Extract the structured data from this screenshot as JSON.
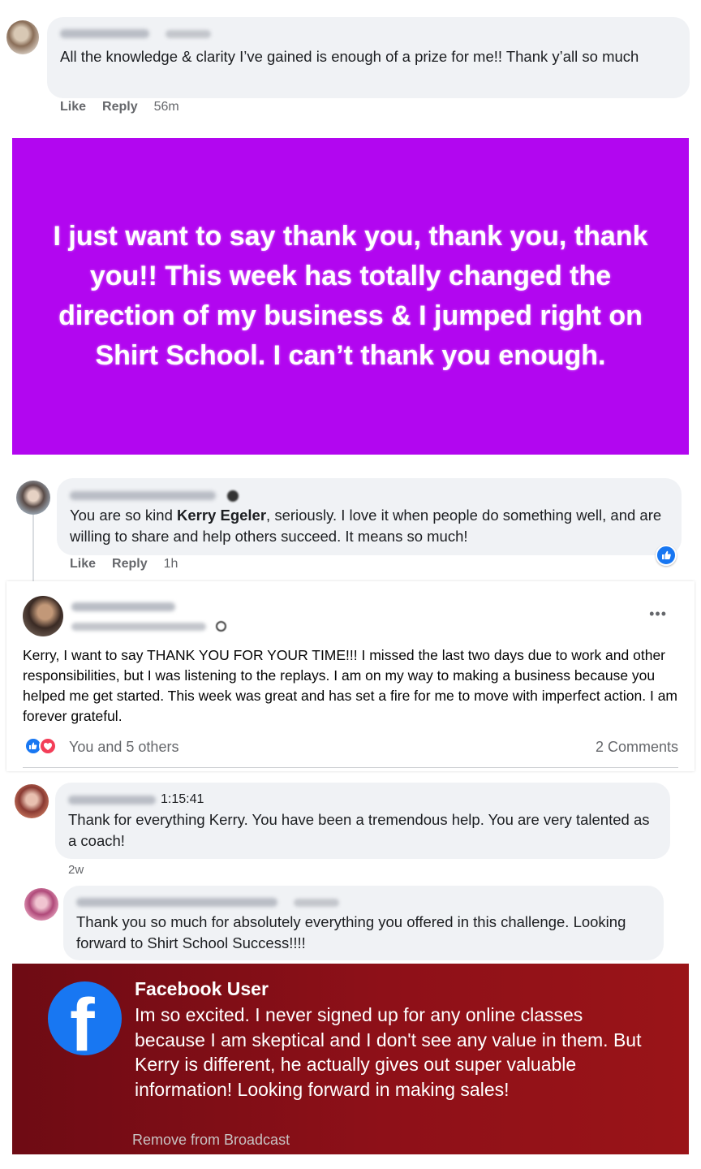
{
  "comment1": {
    "text": "All the knowledge & clarity I’ve gained is enough of a prize for me!! Thank y’all so much",
    "like": "Like",
    "reply": "Reply",
    "ago": "56m"
  },
  "purple_banner": {
    "text": "I just want to say thank you, thank you, thank you!! This week has totally changed the direction of my business & I jumped right on Shirt School. I can’t thank you enough."
  },
  "comment2": {
    "text_before": "You are so kind ",
    "mention": "Kerry Egeler",
    "text_after": ", seriously. I love it when people do something well, and are willing to share and help others succeed. It means so much!",
    "like": "Like",
    "reply": "Reply",
    "ago": "1h"
  },
  "post": {
    "text": "Kerry, I want to say THANK YOU FOR YOUR TIME!!! I missed the last two days due to work and other responsibilities, but I was listening to the replays. I am on my way to making a business because you helped me get started. This week was great and has set a fire for me to move with imperfect action. I am forever grateful.",
    "reactions": "You and 5 others",
    "comments": "2 Comments",
    "more": "•••"
  },
  "comment3": {
    "time": "1:15:41",
    "text": "Thank for everything Kerry. You have been a tremendous help. You are very talented as a coach!",
    "ago": "2w"
  },
  "comment4": {
    "text": "Thank you so much for absolutely everything you offered in this challenge. Looking forward to Shirt School Success!!!!"
  },
  "broadcast": {
    "user": "Facebook User",
    "message": "Im so excited. I never signed up for any online classes because I am skeptical and I don't see any value in them. But Kerry is different, he actually gives out super valuable information! Looking forward in making sales!",
    "remove": "Remove from Broadcast",
    "logo_letter": "f"
  },
  "colors": {
    "purple": "#b206f0",
    "facebook_blue": "#1877f2",
    "broadcast_red": "#8e1018",
    "bubble_gray": "#f0f2f5"
  }
}
